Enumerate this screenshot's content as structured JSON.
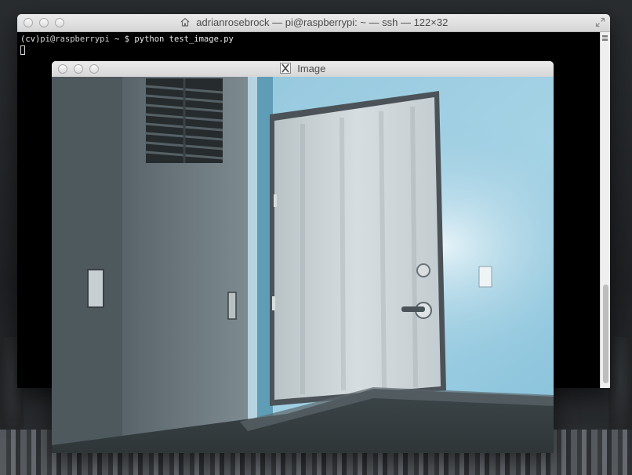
{
  "terminal": {
    "title": "adrianrosebrock — pi@raspberrypi: ~ — ssh — 122×32",
    "prompt_env": "(cv)",
    "prompt_host": "pi@raspberrypi",
    "prompt_path": " ~ $ ",
    "command": "python test_image.py",
    "title_icon": "home-icon",
    "scrollbar_position": 0.7
  },
  "image_window": {
    "title": "Image",
    "title_icon": "x11-icon"
  },
  "colors": {
    "sky": "#8ec5dc",
    "wall": "#6f7a80",
    "door": "#c9d3d6",
    "terminal_bg": "#000000"
  }
}
